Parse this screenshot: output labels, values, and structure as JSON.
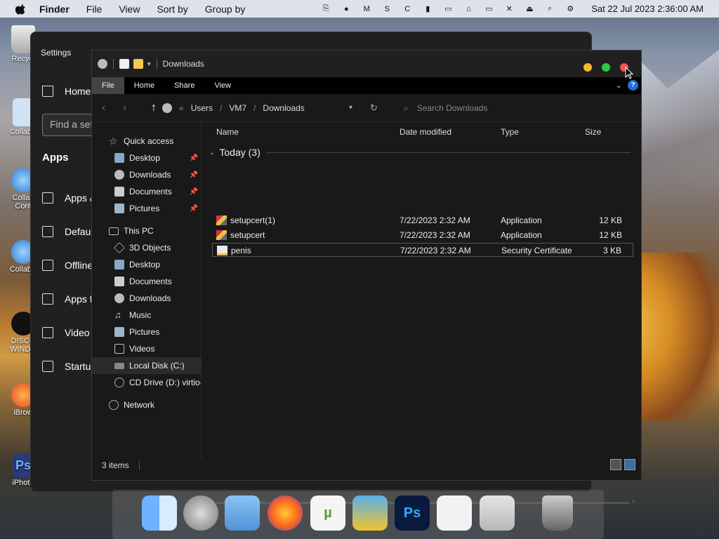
{
  "menubar": {
    "app_name": "Finder",
    "menus": [
      "File",
      "View",
      "Sort by",
      "Group by"
    ],
    "clock": "Sat 22 Jul 2023  2:36:00 AM",
    "status_icons": [
      "clipboard-icon",
      "sync-icon",
      "memory-icon",
      "disk-icon",
      "cpu-icon",
      "battery-icon",
      "display-icon",
      "storage-icon",
      "monitor-icon",
      "mute-icon",
      "eject-icon",
      "search-icon",
      "control-center-icon"
    ],
    "status_glyphs": [
      "⎘",
      "●",
      "M",
      "S",
      "C",
      "▮",
      "▭",
      "⌂",
      "▭",
      "✕",
      "⏏",
      "⌕",
      "⚙"
    ]
  },
  "desktop_icons": [
    "Recycl",
    "CollabS",
    "Collab\nCont",
    "CollabS",
    "DISCO\nWINDO",
    "iBrow",
    "iPhoto"
  ],
  "settings": {
    "title": "Settings",
    "home": "Home",
    "find_placeholder": "Find a set",
    "apps_heading": "Apps",
    "nav": [
      "Apps &",
      "Defaul",
      "Offline",
      "Apps f",
      "Video",
      "Startup"
    ]
  },
  "explorer": {
    "title": "Downloads",
    "ribbon_tabs": [
      "File",
      "Home",
      "Share",
      "View"
    ],
    "help": "?",
    "path": [
      "Users",
      "VM7",
      "Downloads"
    ],
    "path_prefix": "«",
    "search_placeholder": "Search Downloads",
    "sidebar": {
      "quick_access": "Quick access",
      "quick_items": [
        "Desktop",
        "Downloads",
        "Documents",
        "Pictures"
      ],
      "this_pc": "This PC",
      "pc_items": [
        "3D Objects",
        "Desktop",
        "Documents",
        "Downloads",
        "Music",
        "Pictures",
        "Videos",
        "Local Disk (C:)",
        "CD Drive (D:) virtio-"
      ],
      "network": "Network"
    },
    "columns": [
      "Name",
      "Date modified",
      "Type",
      "Size"
    ],
    "group_label": "Today (3)",
    "files": [
      {
        "name": "setupcert(1)",
        "date": "7/22/2023 2:32 AM",
        "type": "Application",
        "size": "12 KB"
      },
      {
        "name": "setupcert",
        "date": "7/22/2023 2:32 AM",
        "type": "Application",
        "size": "12 KB"
      },
      {
        "name": "penis",
        "date": "7/22/2023 2:32 AM",
        "type": "Security Certificate",
        "size": "3 KB"
      }
    ],
    "status": "3 items"
  },
  "dock": [
    "finder-icon",
    "launchpad-icon",
    "folder-icon",
    "firefox-icon",
    "utorrent-icon",
    "app-icon",
    "photoshop-icon",
    "apple-icon",
    "settings-icon",
    "trash-icon"
  ],
  "dock_labels": {
    "photoshop": "Ps"
  },
  "colors": {
    "traffic_min": "#f5b82e",
    "traffic_max": "#31c744",
    "traffic_close": "#f0544c",
    "accent": "#1e6fd9"
  }
}
